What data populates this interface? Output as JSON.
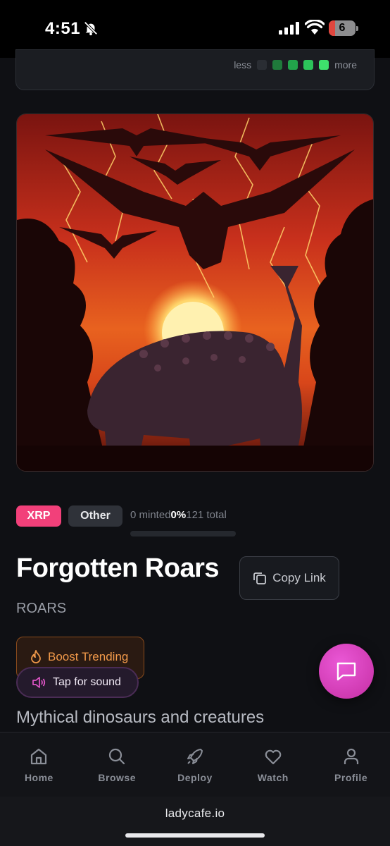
{
  "status": {
    "time": "4:51",
    "battery": "6"
  },
  "heatmap_legend": {
    "less": "less",
    "more": "more",
    "colors": [
      "#2a2d33",
      "#1f7a3b",
      "#22a34b",
      "#2cc45a",
      "#3ee06c"
    ]
  },
  "collection": {
    "chain_tag": "XRP",
    "category_tag": "Other",
    "minted_text": "0 minted",
    "percent": "0%",
    "total_text": "121 total",
    "progress_fraction": 0,
    "title": "Forgotten Roars",
    "symbol": "ROARS",
    "description": "Mythical dinosaurs and creatures"
  },
  "actions": {
    "copy_link": "Copy Link",
    "boost_trending": "Boost Trending",
    "tap_sound": "Tap for sound"
  },
  "nav": {
    "items": [
      {
        "label": "Home",
        "icon": "home-icon"
      },
      {
        "label": "Browse",
        "icon": "search-icon"
      },
      {
        "label": "Deploy",
        "icon": "rocket-icon"
      },
      {
        "label": "Watch",
        "icon": "heart-icon"
      },
      {
        "label": "Profile",
        "icon": "user-icon"
      }
    ]
  },
  "browser": {
    "url": "ladycafe.io"
  },
  "colors": {
    "accent_pink": "#f2407a",
    "fab": "#d43fb8",
    "boost_orange": "#f29a4a"
  }
}
